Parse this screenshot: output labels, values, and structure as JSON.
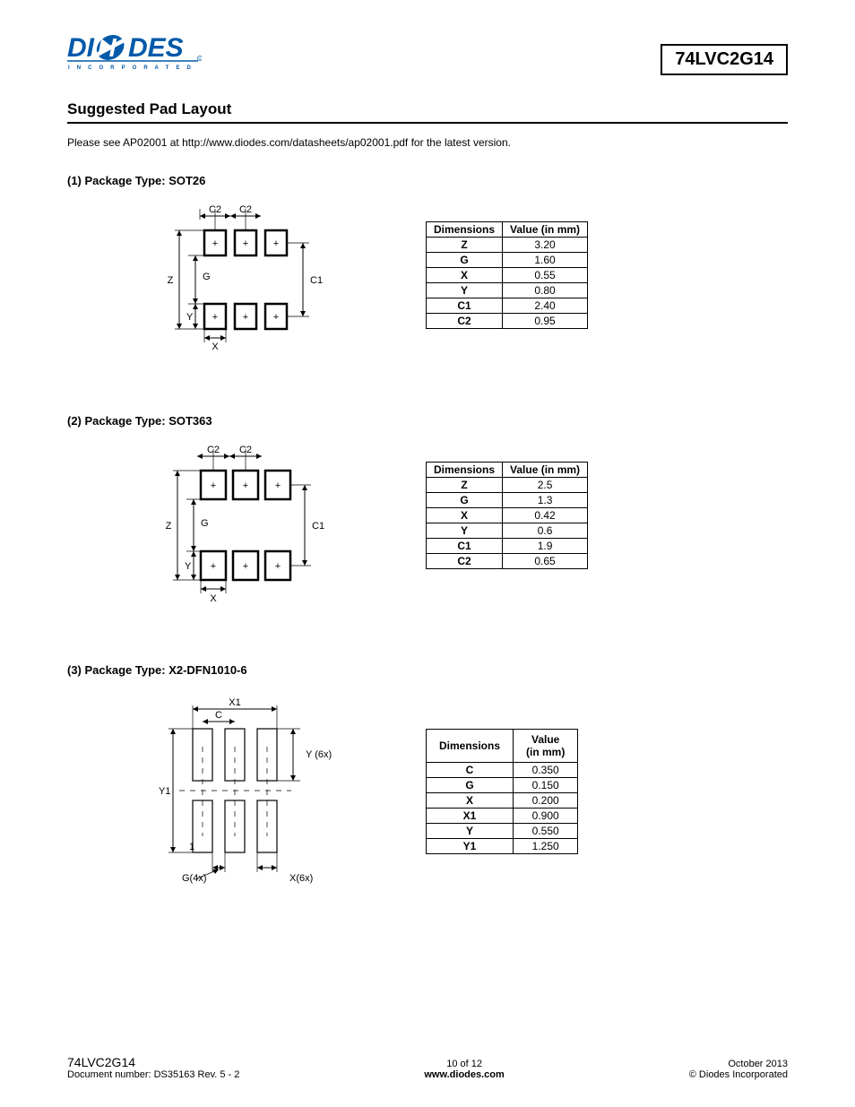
{
  "header": {
    "logo_main": "DIODES",
    "logo_sub": "I N C O R P O R A T E D",
    "part_number": "74LVC2G14"
  },
  "section_title": "Suggested Pad Layout",
  "intro": "Please see AP02001 at http://www.diodes.com/datasheets/ap02001.pdf for the latest version.",
  "pkg1_head": "(1)   Package Type: SOT26",
  "pkg2_head": "(2)   Package Type: SOT363",
  "pkg3_head": "(3)   Package Type: X2-DFN1010-6",
  "th_dim": "Dimensions",
  "th_val": "Value (in mm)",
  "th_val2a": "Value",
  "th_val2b": "(in mm)",
  "t1": {
    "r0d": "Z",
    "r0v": "3.20",
    "r1d": "G",
    "r1v": "1.60",
    "r2d": "X",
    "r2v": "0.55",
    "r3d": "Y",
    "r3v": "0.80",
    "r4d": "C1",
    "r4v": "2.40",
    "r5d": "C2",
    "r5v": "0.95"
  },
  "t2": {
    "r0d": "Z",
    "r0v": "2.5",
    "r1d": "G",
    "r1v": "1.3",
    "r2d": "X",
    "r2v": "0.42",
    "r3d": "Y",
    "r3v": "0.6",
    "r4d": "C1",
    "r4v": "1.9",
    "r5d": "C2",
    "r5v": "0.65"
  },
  "t3": {
    "r0d": "C",
    "r0v": "0.350",
    "r1d": "G",
    "r1v": "0.150",
    "r2d": "X",
    "r2v": "0.200",
    "r3d": "X1",
    "r3v": "0.900",
    "r4d": "Y",
    "r4v": "0.550",
    "r5d": "Y1",
    "r5v": "1.250"
  },
  "diag": {
    "C2": "C2",
    "Z": "Z",
    "G": "G",
    "C1": "C1",
    "Y": "Y",
    "X": "X",
    "X1": "X1",
    "C": "C",
    "Y6x": "Y (6x)",
    "Y1": "Y1",
    "one": "1",
    "G4x": "G(4x)",
    "X6x": "X(6x)"
  },
  "footer": {
    "part": "74LVC2G14",
    "doc": "Document number: DS35163 Rev. 5 - 2",
    "page": "10 of 12",
    "url": "www.diodes.com",
    "date": "October 2013",
    "copy": "© Diodes Incorporated"
  }
}
